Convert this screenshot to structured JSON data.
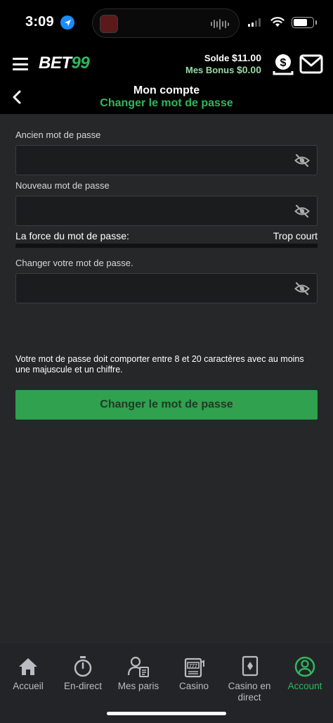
{
  "status_bar": {
    "time": "3:09"
  },
  "header": {
    "logo_white": "BET",
    "logo_green": "99",
    "balance_label": "Solde",
    "balance_value": "$11.00",
    "bonus_label": "Mes Bonus",
    "bonus_value": "$0.00"
  },
  "page": {
    "title": "Mon compte",
    "subtitle": "Changer le mot de passe"
  },
  "form": {
    "old_password_label": "Ancien mot de passe",
    "old_password_value": "",
    "new_password_label": "Nouveau mot de passe",
    "new_password_value": "",
    "strength_label": "La force du mot de passe:",
    "strength_value": "Trop court",
    "strength_percent": 0,
    "confirm_label": "Changer votre mot de passe.",
    "confirm_value": "",
    "hint": "Votre mot de passe doit comporter entre 8 et 20 caractères avec au moins une majuscule et un chiffre.",
    "submit_label": "Changer le mot de passe"
  },
  "tabs": [
    {
      "label": "Accueil",
      "icon": "home-icon"
    },
    {
      "label": "En-direct",
      "icon": "stopwatch-icon"
    },
    {
      "label": "Mes paris",
      "icon": "bet-slip-icon"
    },
    {
      "label": "Casino",
      "icon": "slot-machine-icon"
    },
    {
      "label": "Casino en direct",
      "icon": "playing-card-icon"
    },
    {
      "label": "Account",
      "icon": "account-icon",
      "active": true
    }
  ],
  "colors": {
    "accent_green": "#2eb85c",
    "button_green": "#2fa14f",
    "background": "#262729",
    "header": "#000000"
  }
}
